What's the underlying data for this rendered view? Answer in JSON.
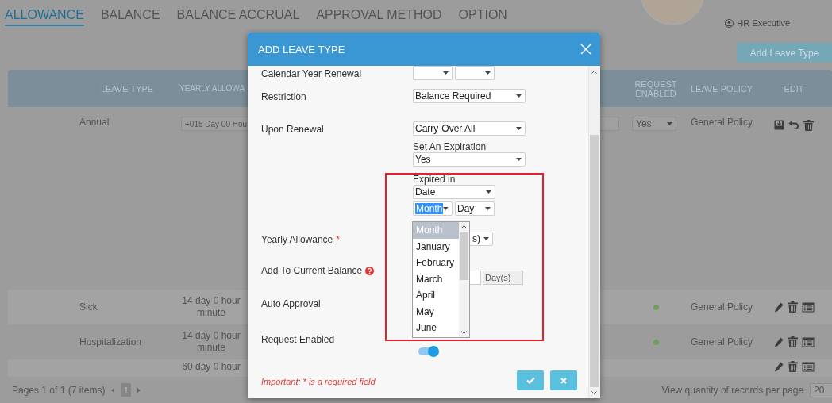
{
  "tabs": [
    {
      "label": "ALLOWANCE",
      "selected": true
    },
    {
      "label": "BALANCE",
      "selected": false
    },
    {
      "label": "BALANCE ACCRUAL",
      "selected": false
    },
    {
      "label": "APPROVAL METHOD",
      "selected": false
    },
    {
      "label": "OPTION",
      "selected": false
    }
  ],
  "user": {
    "role": "HR Executive"
  },
  "add_button": "Add Leave Type",
  "table": {
    "columns": [
      "LEAVE TYPE",
      "YEARLY ALLOWA",
      "REQUEST ENABLED",
      "LEAVE POLICY",
      "EDIT"
    ],
    "rows": [
      {
        "kind": "editing",
        "leave_type": "Annual",
        "yearly_allowance": "+015 Day 00 Hou",
        "request_enabled": "Yes",
        "leave_policy": "General Policy"
      },
      {
        "kind": "view",
        "leave_type": "Sick",
        "yearly_allowance": "14 day 0 hour minute",
        "request_enabled": true,
        "leave_policy": "General Policy"
      },
      {
        "kind": "view",
        "leave_type": "Hospitalization",
        "yearly_allowance": "14 day 0 hour minute",
        "request_enabled": true,
        "leave_policy": "General Policy"
      },
      {
        "kind": "view",
        "yearly_allowance": "60 day 0 hour"
      }
    ]
  },
  "pager": {
    "summary": "Pages 1 of 1 (7 items)",
    "pages": [
      {
        "label": "1",
        "selected": true
      }
    ],
    "per_page_label": "View quantity of records per page",
    "per_page": "20"
  },
  "modal": {
    "title": "ADD LEAVE TYPE",
    "fields": [
      {
        "kind": "double-select",
        "label": "Calendar Year Renewal"
      },
      {
        "kind": "select",
        "label": "Restriction",
        "value": "Balance Required"
      },
      {
        "kind": "renewal",
        "label": "Upon Renewal",
        "value": "Carry-Over All",
        "expiration_label": "Set An Expiration",
        "expiration_value": "Yes",
        "expired_in_label": "Expired in",
        "expired_in_value": "Date",
        "month_value": "Month",
        "month_focused": true,
        "day_value": "Day"
      },
      {
        "kind": "covered-select",
        "label": "Yearly Allowance",
        "required_mark": "*",
        "value": "s)"
      },
      {
        "kind": "addon",
        "label": "Add To Current Balance",
        "help": true,
        "unit": "Day(s)"
      },
      {
        "kind": "plain",
        "label": "Auto Approval"
      },
      {
        "kind": "toggle",
        "label": "Request Enabled",
        "on": true
      }
    ],
    "dropdown": {
      "options": [
        {
          "label": "Month",
          "selected": true
        },
        {
          "label": "January",
          "selected": false
        },
        {
          "label": "February",
          "selected": false
        },
        {
          "label": "March",
          "selected": false
        },
        {
          "label": "April",
          "selected": false
        },
        {
          "label": "May",
          "selected": false
        },
        {
          "label": "June",
          "selected": false
        }
      ]
    },
    "note": "Important: * is a required field",
    "buttons": [
      {
        "kind": "confirm"
      },
      {
        "kind": "cancel"
      }
    ]
  }
}
